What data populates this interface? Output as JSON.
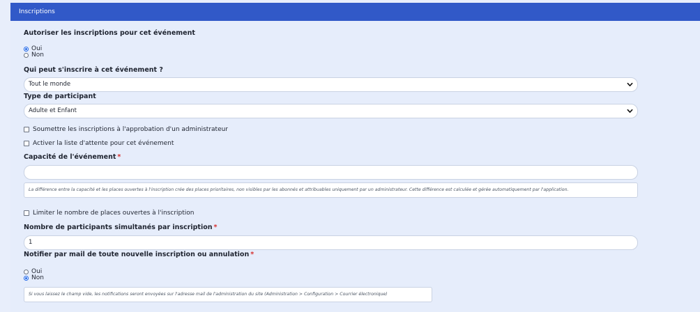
{
  "header": {
    "title": "Inscriptions"
  },
  "fields": {
    "allow": {
      "label": "Autoriser les inscriptions pour cet événement",
      "options": [
        "Oui",
        "Non"
      ],
      "selected": "Oui"
    },
    "who": {
      "label": "Qui peut s'inscrire à cet événement ?",
      "value": "Tout le monde"
    },
    "type": {
      "label": "Type de participant",
      "value": "Adulte et Enfant"
    },
    "approval": {
      "label": "Soumettre les inscriptions à l'approbation d'un administrateur",
      "checked": false
    },
    "waitlist": {
      "label": "Activer la liste d'attente pour cet événement",
      "checked": false
    },
    "capacity": {
      "label": "Capacité de l'événement",
      "required": "*",
      "value": ""
    },
    "capacity_help": "La différence entre la capacité et les places ouvertes à l'inscription crée des places prioritaires, non visibles par les abonnés et attribuables uniquement par un administrateur. Cette différence est calculée et gérée automatiquement par l'application.",
    "limit": {
      "label": "Limiter le nombre de places ouvertes à l'inscription",
      "checked": false
    },
    "simultaneous": {
      "label": "Nombre de participants simultanés par inscription",
      "required": "*",
      "value": "1"
    },
    "notify": {
      "label": "Notifier par mail de toute nouvelle inscription ou annulation",
      "required": "*",
      "options": [
        "Oui",
        "Non"
      ],
      "selected": "Non"
    },
    "notify_help": "Si vous laissez le champ vide, les notifications seront envoyées sur l'adresse mail de l'administration du site (Administration > Configuration > Courrier électronique)"
  },
  "colors": {
    "header": "#3159c8",
    "background": "#e8eefb",
    "accent": "#1e66e8",
    "required": "#d6312f"
  },
  "icons": {
    "select_chevron": "chevron-down-icon"
  }
}
